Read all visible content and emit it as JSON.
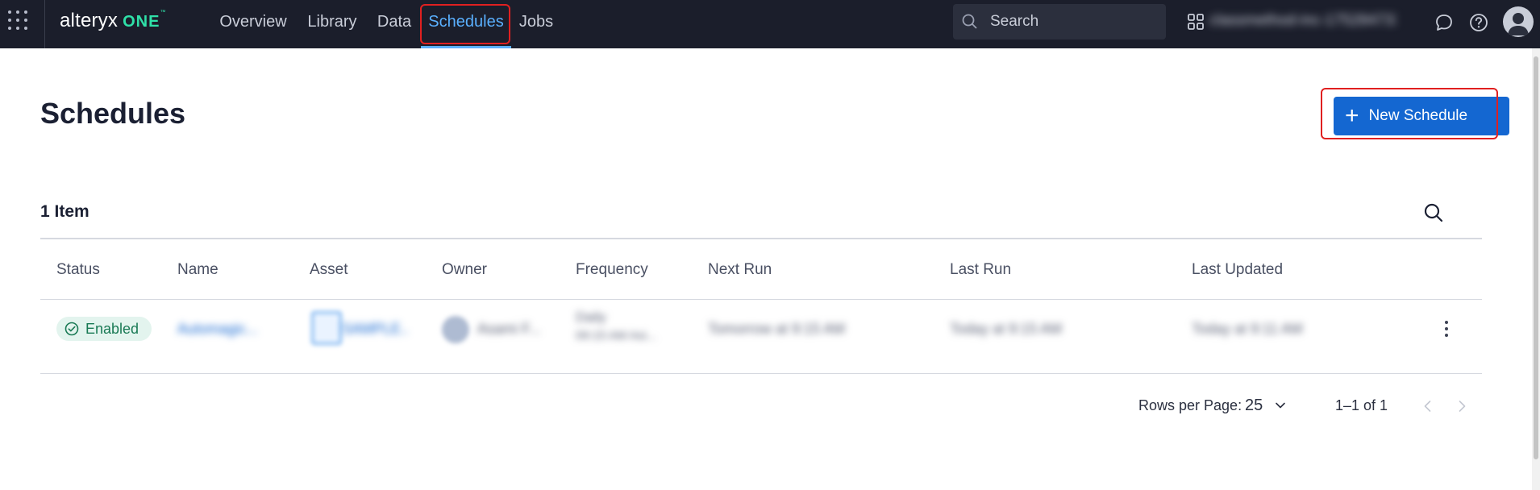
{
  "topbar": {
    "brand": {
      "main": "alteryx",
      "accent": "ONE",
      "tm": "™"
    },
    "nav": [
      {
        "label": "Overview",
        "active": false
      },
      {
        "label": "Library",
        "active": false
      },
      {
        "label": "Data",
        "active": false
      },
      {
        "label": "Schedules",
        "active": true
      },
      {
        "label": "Jobs",
        "active": false
      }
    ],
    "search_placeholder": "Search",
    "workspace_name": "classmethod-inc-1752847330",
    "icons": [
      "apps-grid-icon",
      "search-icon",
      "workspaces-icon",
      "chat-icon",
      "help-icon",
      "user-avatar-icon"
    ]
  },
  "page": {
    "title": "Schedules",
    "new_button": {
      "icon": "plus-icon",
      "label": "New Schedule"
    }
  },
  "table": {
    "count": "1 Item",
    "columns": [
      "Status",
      "Name",
      "Asset",
      "Owner",
      "Frequency",
      "Next Run",
      "Last Run",
      "Last Updated"
    ],
    "rows": [
      {
        "status": "Enabled",
        "name": "Automagic...",
        "asset": "SAMPLE...",
        "owner": "Asami F...",
        "frequency": "Daily",
        "frequency_detail": "09:15 AM Asi...",
        "next_run": "Tomorrow at 9:15 AM",
        "last_run": "Today at 9:15 AM",
        "last_updated": "Today at 9:11 AM"
      }
    ]
  },
  "pagination": {
    "rows_per_page_label": "Rows per Page:",
    "rows_per_page_value": "25",
    "range": "1–1 of 1"
  },
  "colors": {
    "topbar_bg": "#1b1e2b",
    "active_tab": "#5ab0ff",
    "primary_button": "#1467d1",
    "status_enabled_bg": "#e3f4ee",
    "status_enabled_text": "#1a7a55",
    "highlight_box": "#e02020"
  }
}
